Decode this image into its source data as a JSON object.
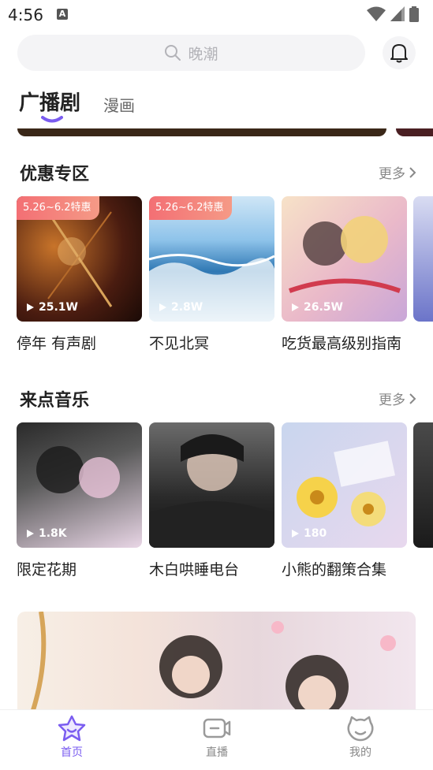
{
  "status": {
    "time": "4:56",
    "notif_icon": "A"
  },
  "search": {
    "placeholder": "晚潮"
  },
  "tabs": [
    {
      "label": "广播剧",
      "active": true
    },
    {
      "label": "漫画",
      "active": false
    }
  ],
  "sections": {
    "discount": {
      "title": "优惠专区",
      "more": "更多",
      "items": [
        {
          "badge": "5.26~6.2特惠",
          "plays": "25.1W",
          "title": "停年 有声剧"
        },
        {
          "badge": "5.26~6.2特惠",
          "plays": "2.8W",
          "title": "不见北冥"
        },
        {
          "plays": "26.5W",
          "title": "吃货最高级别指南"
        }
      ]
    },
    "music": {
      "title": "来点音乐",
      "more": "更多",
      "items": [
        {
          "plays": "1.8K",
          "title": "限定花期"
        },
        {
          "title": "木白哄睡电台"
        },
        {
          "plays": "180",
          "title": "小熊的翻策合集"
        }
      ]
    }
  },
  "bottom_nav": [
    {
      "label": "首页",
      "active": true,
      "icon": "home-star-icon"
    },
    {
      "label": "直播",
      "active": false,
      "icon": "live-icon"
    },
    {
      "label": "我的",
      "active": false,
      "icon": "profile-icon"
    }
  ],
  "colors": {
    "accent": "#7a5cf0",
    "badge": "#f36f74"
  }
}
